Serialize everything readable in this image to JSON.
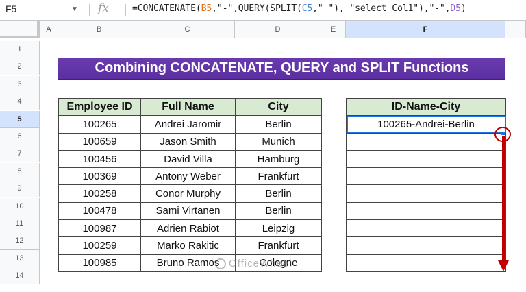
{
  "formula_bar": {
    "cell_ref": "F5",
    "fx_label": "fx",
    "formula_parts": [
      {
        "text": "=CONCATENATE(",
        "cls": ""
      },
      {
        "text": "B5",
        "cls": "r1"
      },
      {
        "text": ",\"-\",QUERY(SPLIT(",
        "cls": ""
      },
      {
        "text": "C5",
        "cls": "r2"
      },
      {
        "text": ",\" \"), \"select Col1\"),\"-\",",
        "cls": ""
      },
      {
        "text": "D5",
        "cls": "r3"
      },
      {
        "text": ")",
        "cls": ""
      }
    ]
  },
  "columns": [
    "A",
    "B",
    "C",
    "D",
    "E",
    "F"
  ],
  "rows": [
    "1",
    "2",
    "3",
    "4",
    "5",
    "6",
    "7",
    "8",
    "9",
    "10",
    "11",
    "12",
    "13",
    "14"
  ],
  "banner_title": "Combining CONCATENATE, QUERY and SPLIT Functions",
  "data_table": {
    "headers": [
      "Employee ID",
      "Full Name",
      "City"
    ],
    "rows": [
      [
        "100265",
        "Andrei Jaromir",
        "Berlin"
      ],
      [
        "100659",
        "Jason Smith",
        "Munich"
      ],
      [
        "100456",
        "David Villa",
        "Hamburg"
      ],
      [
        "100369",
        "Antony Weber",
        "Frankfurt"
      ],
      [
        "100258",
        "Conor Murphy",
        "Berlin"
      ],
      [
        "100478",
        "Sami Virtanen",
        "Berlin"
      ],
      [
        "100987",
        "Adrien Rabiot",
        "Leipzig"
      ],
      [
        "100259",
        "Marko Rakitic",
        "Frankfurt"
      ],
      [
        "100985",
        "Bruno Ramos",
        "Cologne"
      ]
    ]
  },
  "result_table": {
    "header": "ID-Name-City",
    "rows": [
      "100265-Andrei-Berlin",
      "",
      "",
      "",
      "",
      "",
      "",
      "",
      ""
    ]
  },
  "watermark": "OfficeWheel",
  "colors": {
    "banner": "#5b2fa0",
    "header_fill": "#d9ead3",
    "selection": "#1a73e8",
    "arrow": "#c00000"
  }
}
